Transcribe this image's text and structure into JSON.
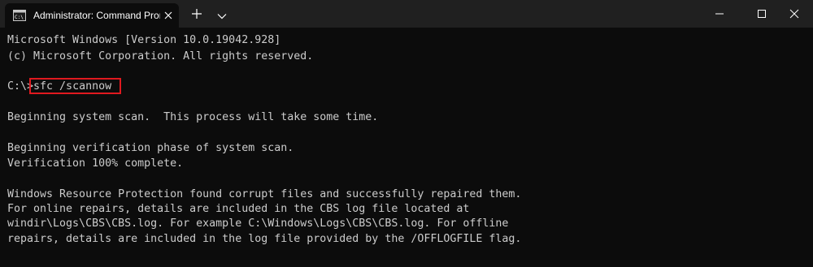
{
  "window": {
    "tab_title": "Administrator: Command Prompt",
    "tab_icon": "terminal-icon",
    "close_tab_icon": "close-icon",
    "new_tab_icon": "plus-icon",
    "dropdown_icon": "chevron-down-icon",
    "controls": {
      "minimize_icon": "minimize-icon",
      "maximize_icon": "maximize-icon",
      "close_icon": "close-icon"
    }
  },
  "colors": {
    "background": "#0c0c0c",
    "titlebar": "#202020",
    "text": "#cccccc",
    "highlight_border": "#e0191f"
  },
  "console": {
    "banner_line1": "Microsoft Windows [Version 10.0.19042.928]",
    "banner_line2": "(c) Microsoft Corporation. All rights reserved.",
    "prompt": "C:\\>",
    "command": "sfc /scannow",
    "scan_begin": "Beginning system scan.  This process will take some time.",
    "verify_begin": "Beginning verification phase of system scan.",
    "verify_complete": "Verification 100% complete.",
    "result_line1": "Windows Resource Protection found corrupt files and successfully repaired them.",
    "result_line2": "For online repairs, details are included in the CBS log file located at",
    "result_line3": "windir\\Logs\\CBS\\CBS.log. For example C:\\Windows\\Logs\\CBS\\CBS.log. For offline",
    "result_line4": "repairs, details are included in the log file provided by the /OFFLOGFILE flag."
  }
}
